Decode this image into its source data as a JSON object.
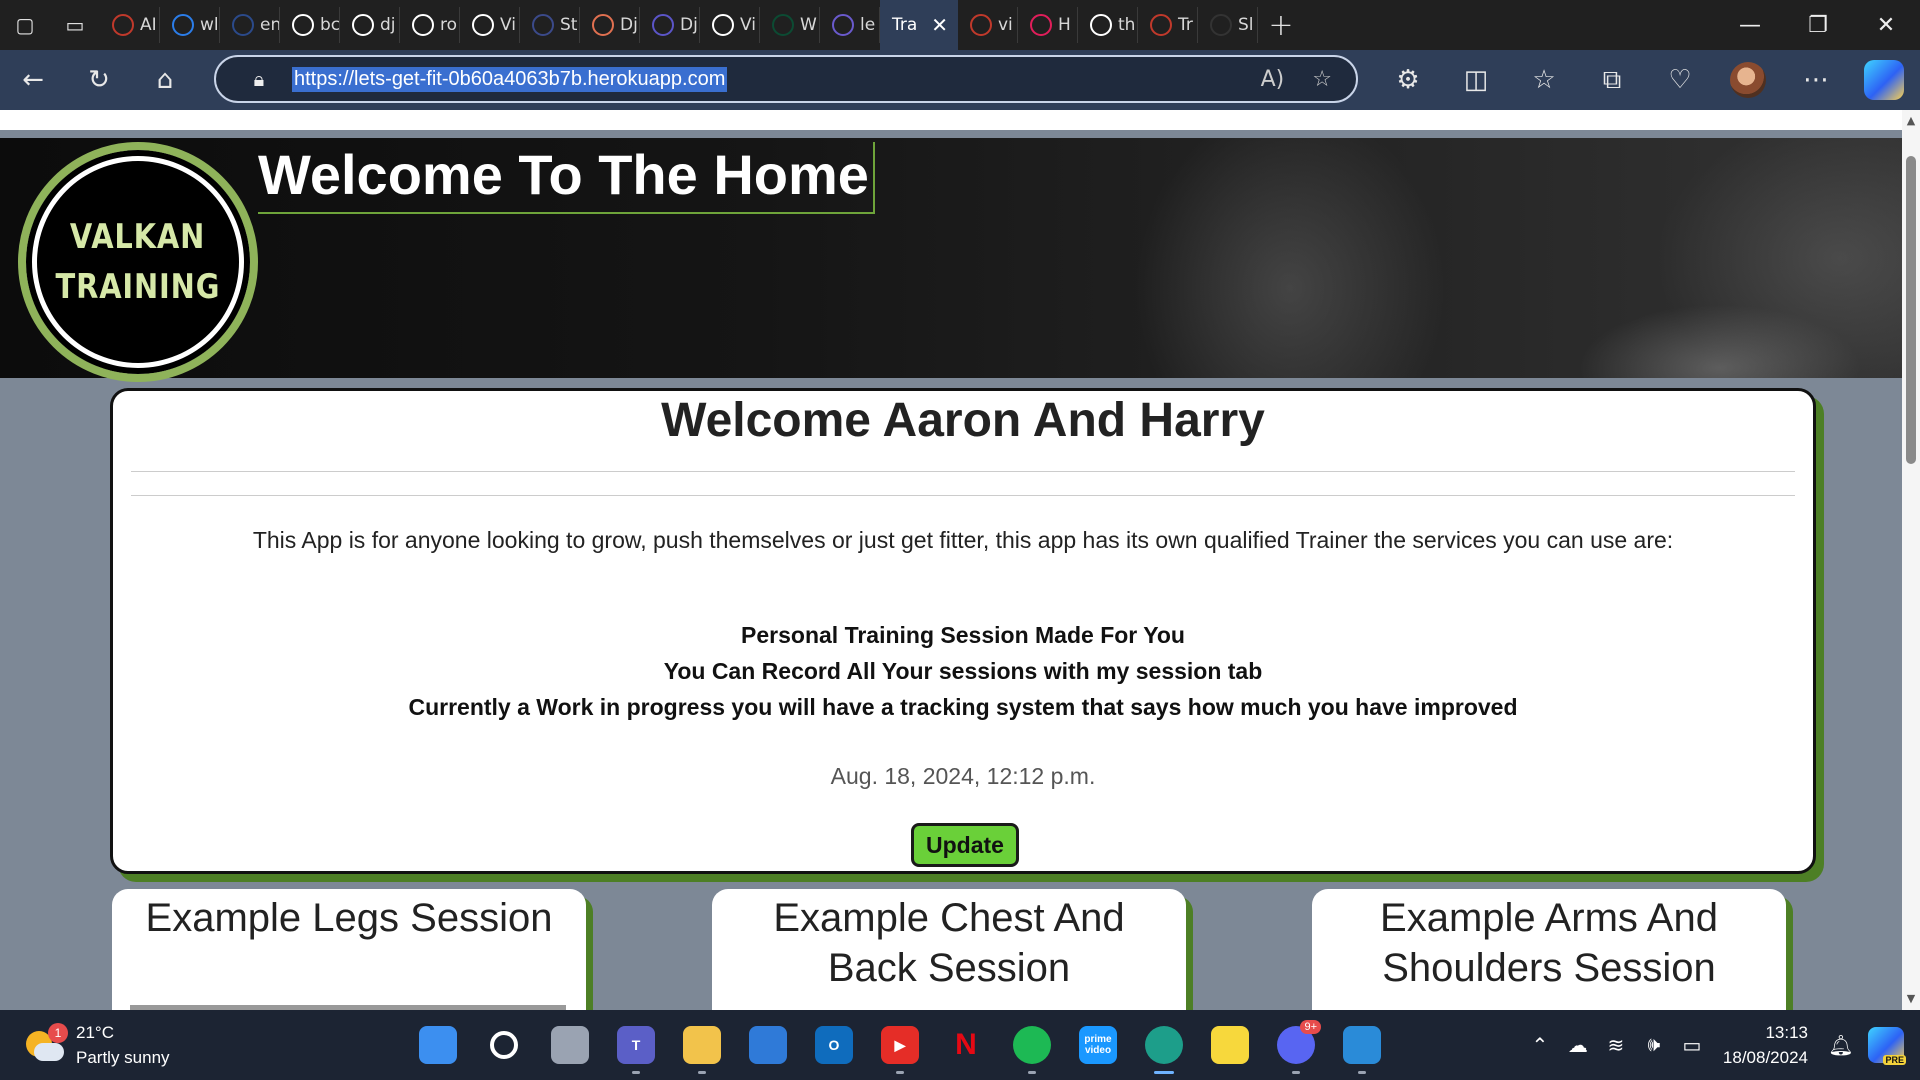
{
  "browser": {
    "tabs": [
      {
        "label": "AI",
        "icon": "opera-icon",
        "color": "#c0392b"
      },
      {
        "label": "wl",
        "icon": "bing-icon",
        "color": "#2b7de9"
      },
      {
        "label": "en",
        "icon": "search-icon",
        "color": "#2b4a8a"
      },
      {
        "label": "bc",
        "icon": "github-icon",
        "color": "#ffffff"
      },
      {
        "label": "dj",
        "icon": "github-icon",
        "color": "#ffffff"
      },
      {
        "label": "ro",
        "icon": "google-icon",
        "color": "#ffffff"
      },
      {
        "label": "Vi",
        "icon": "github-icon",
        "color": "#ffffff"
      },
      {
        "label": "St",
        "icon": "s-icon",
        "color": "#3b4a8a"
      },
      {
        "label": "Dj",
        "icon": "g-icon",
        "color": "#e07050"
      },
      {
        "label": "Dj",
        "icon": "s-icon",
        "color": "#5b55c8"
      },
      {
        "label": "Vi",
        "icon": "github-icon",
        "color": "#ffffff"
      },
      {
        "label": "W",
        "icon": "django-icon",
        "color": "#0c4b33"
      },
      {
        "label": "le",
        "icon": "h-icon",
        "color": "#6a5acd"
      }
    ],
    "active_tab": {
      "label": "Tra",
      "close": "✕"
    },
    "tabs_after": [
      {
        "label": "vi",
        "icon": "red-icon",
        "color": "#c0392b"
      },
      {
        "label": "H",
        "icon": "slack-icon",
        "color": "#e01e5a"
      },
      {
        "label": "th",
        "icon": "github-icon",
        "color": "#ffffff"
      },
      {
        "label": "Tr",
        "icon": "red-icon",
        "color": "#c0392b"
      },
      {
        "label": "Sl",
        "icon": "nu-icon",
        "color": "#333333"
      }
    ],
    "new_tab": "+",
    "window_controls": {
      "minimize": "—",
      "restore": "❐",
      "close": "✕"
    },
    "url": "https://lets-get-fit-0b60a4063b7b.herokuapp.com"
  },
  "page": {
    "hero_title": "Welcome To The Home",
    "logo_line1": "VALKAN",
    "logo_line2": "TRAINING",
    "welcome_heading": "Welcome Aaron And Harry",
    "intro": "This App is for anyone looking to grow, push themselves or just get fitter, this app has its own qualified Trainer the services you can use are:",
    "features": [
      "Personal Training Session Made For You",
      "You Can Record All Your sessions with my session tab",
      "Currently a Work in progress you will have a tracking system that says how much you have improved"
    ],
    "date": "Aug. 18, 2024, 12:12 p.m.",
    "update_label": "Update",
    "example_cards": [
      {
        "title": "Example Legs Session"
      },
      {
        "title": "Example Chest And Back Session"
      },
      {
        "title": "Example Arms And Shoulders Session"
      }
    ],
    "accent_green": "#6ad039",
    "shadow_green": "#4d7f25"
  },
  "taskbar": {
    "weather_temp": "21°C",
    "weather_desc": "Partly sunny",
    "weather_badge": "1",
    "apps": [
      {
        "name": "windows-start",
        "label": ""
      },
      {
        "name": "search",
        "label": ""
      },
      {
        "name": "task-view",
        "label": ""
      },
      {
        "name": "teams",
        "label": "T"
      },
      {
        "name": "file-explorer",
        "label": ""
      },
      {
        "name": "microsoft-store",
        "label": ""
      },
      {
        "name": "outlook",
        "label": "O"
      },
      {
        "name": "youtube",
        "label": "▶"
      },
      {
        "name": "netflix",
        "label": "N"
      },
      {
        "name": "spotify",
        "label": ""
      },
      {
        "name": "prime-video",
        "label": "prime video"
      },
      {
        "name": "edge",
        "label": ""
      },
      {
        "name": "sticky-notes",
        "label": ""
      },
      {
        "name": "discord",
        "label": "",
        "badge": "9+"
      },
      {
        "name": "vscode",
        "label": ""
      }
    ],
    "time": "13:13",
    "date": "18/08/2024",
    "pre_label": "PRE"
  }
}
